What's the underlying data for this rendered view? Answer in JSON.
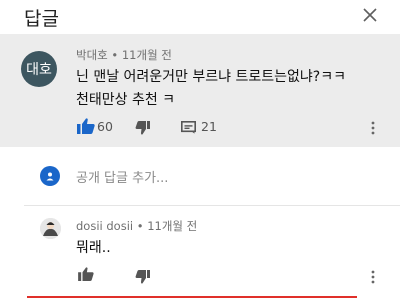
{
  "header": {
    "title": "답글",
    "close_icon": "close-icon"
  },
  "comment": {
    "avatar_text": "대호",
    "author": "박대호",
    "separator": "•",
    "time": "11개월 전",
    "line1": "닌 맨날 어려운거만 부르냐 트로트는없냐?ㅋㅋ",
    "line2": "천태만상 추천 ㅋ",
    "likes": "60",
    "replies": "21",
    "icons": [
      "thumb-up-filled-icon",
      "thumb-down-icon",
      "comment-icon",
      "more-vertical-icon"
    ]
  },
  "reply_input": {
    "placeholder": "공개 답글 추가..."
  },
  "reply": {
    "author": "dosii dosii",
    "separator": "•",
    "time": "11개월 전",
    "text": "뭐래..",
    "icons": [
      "thumb-up-icon",
      "thumb-down-icon",
      "more-vertical-icon"
    ]
  },
  "colors": {
    "highlight_bg": "#ececec",
    "avatar_bg": "#3d5660",
    "like_blue": "#1a66c9",
    "accent_red": "#e0302a"
  }
}
